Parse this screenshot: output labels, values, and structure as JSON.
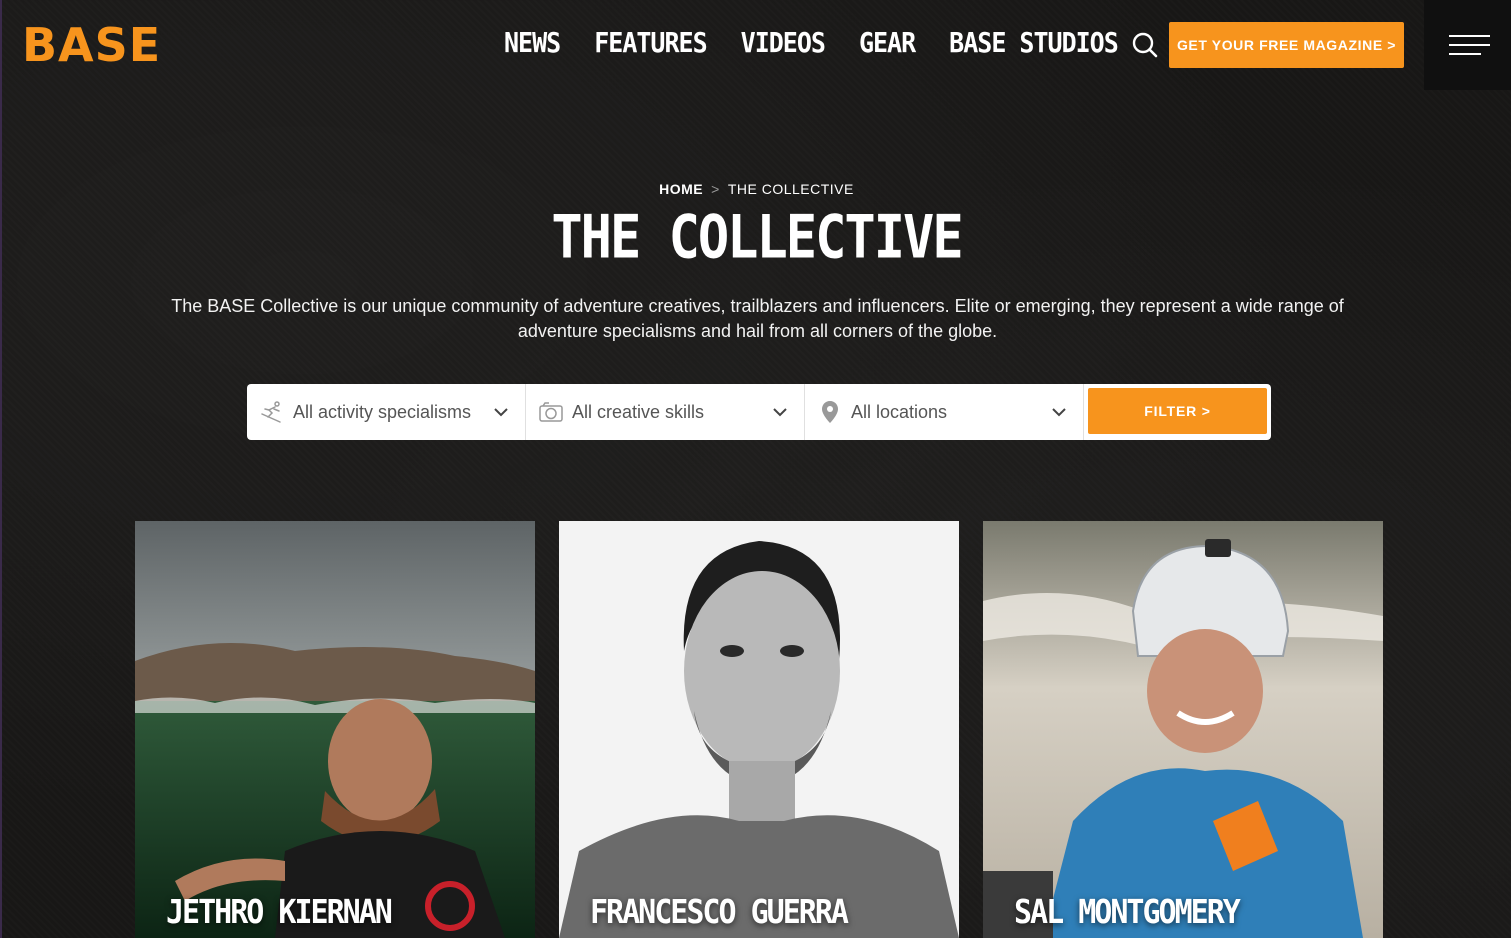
{
  "header": {
    "logo": "BASE",
    "nav": [
      "NEWS",
      "FEATURES",
      "VIDEOS",
      "GEAR",
      "BASE STUDIOS"
    ],
    "cta_label": "GET YOUR FREE MAGAZINE >",
    "search_icon": "search-icon",
    "menu_icon": "hamburger-icon"
  },
  "breadcrumb": {
    "home": "HOME",
    "separator": ">",
    "current": "THE COLLECTIVE"
  },
  "page_title": "THE COLLECTIVE",
  "intro": "The BASE Collective is our unique community of adventure creatives, trailblazers and influencers. Elite or emerging, they represent a wide range of adventure specialisms and hail from all corners of the globe.",
  "filters": {
    "activity": {
      "value": "All activity specialisms",
      "icon": "skier-icon"
    },
    "skills": {
      "value": "All creative skills",
      "icon": "camera-icon"
    },
    "location": {
      "value": "All locations",
      "icon": "map-pin-icon"
    },
    "button_label": "FILTER >"
  },
  "members": [
    {
      "name": "JETHRO KIERNAN"
    },
    {
      "name": "FRANCESCO GUERRA"
    },
    {
      "name": "SAL MONTGOMERY"
    }
  ],
  "colors": {
    "accent": "#f7941d",
    "background": "#181716"
  }
}
